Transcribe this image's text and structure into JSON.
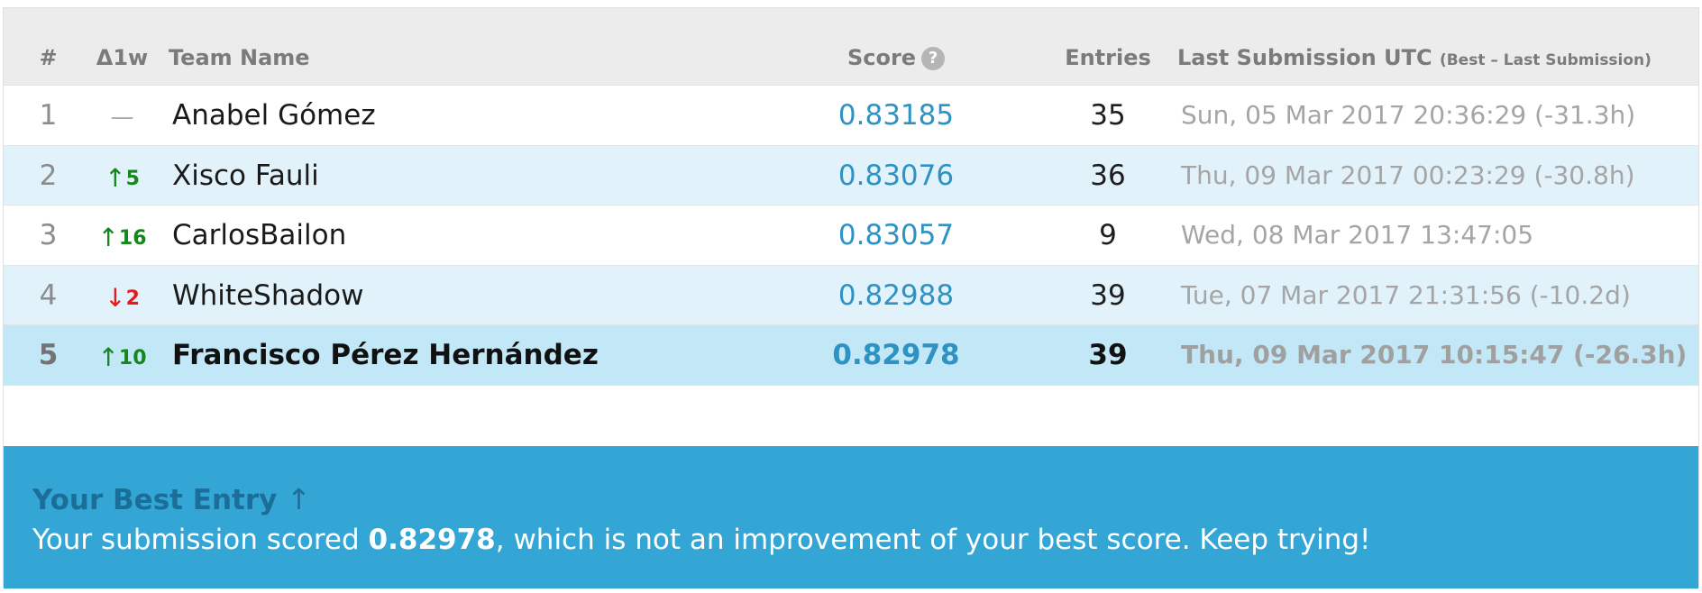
{
  "header": {
    "rank": "#",
    "delta": "Δ1w",
    "team": "Team Name",
    "score": "Score",
    "help_glyph": "?",
    "entries": "Entries",
    "last": "Last Submission UTC",
    "last_note": "(Best – Last Submission)"
  },
  "rows": [
    {
      "rank": "1",
      "delta_arrow": "",
      "delta_value": "—",
      "delta_kind": "none",
      "team": "Anabel Gómez",
      "score": "0.83185",
      "entries": "35",
      "last": "Sun, 05 Mar 2017 20:36:29 (-31.3h)",
      "background": "#ffffff"
    },
    {
      "rank": "2",
      "delta_arrow": "↑",
      "delta_value": "5",
      "delta_kind": "up",
      "team": "Xisco Fauli",
      "score": "0.83076",
      "entries": "36",
      "last": "Thu, 09 Mar 2017 00:23:29 (-30.8h)",
      "background": "#e1f2fa"
    },
    {
      "rank": "3",
      "delta_arrow": "↑",
      "delta_value": "16",
      "delta_kind": "up",
      "team": "CarlosBailon",
      "score": "0.83057",
      "entries": "9",
      "last": "Wed, 08 Mar 2017 13:47:05",
      "background": "#ffffff"
    },
    {
      "rank": "4",
      "delta_arrow": "↓",
      "delta_value": "2",
      "delta_kind": "down",
      "team": "WhiteShadow",
      "score": "0.82988",
      "entries": "39",
      "last": "Tue, 07 Mar 2017 21:31:56 (-10.2d)",
      "background": "#e1f2fa"
    },
    {
      "rank": "5",
      "delta_arrow": "↑",
      "delta_value": "10",
      "delta_kind": "up",
      "team": "Francisco Pérez Hernández",
      "score": "0.82978",
      "entries": "39",
      "last": "Thu, 09 Mar 2017 10:15:47 (-26.3h)",
      "background": "#c2e8f8",
      "is_current_user": true
    }
  ],
  "banner": {
    "title": "Your Best Entry",
    "title_arrow": "↑",
    "msg_before": "Your submission scored ",
    "msg_score": "0.82978",
    "msg_after": ", which is not an improvement of your best score. Keep trying!"
  },
  "colors": {
    "header_bg": "#ececec",
    "score_link": "#2e93c3",
    "delta_up": "#15871d",
    "delta_down": "#e31b1b",
    "banner_bg": "#34a6d6",
    "banner_title": "#1a6e98"
  },
  "icons": {
    "score_help": "help-circle-icon"
  }
}
